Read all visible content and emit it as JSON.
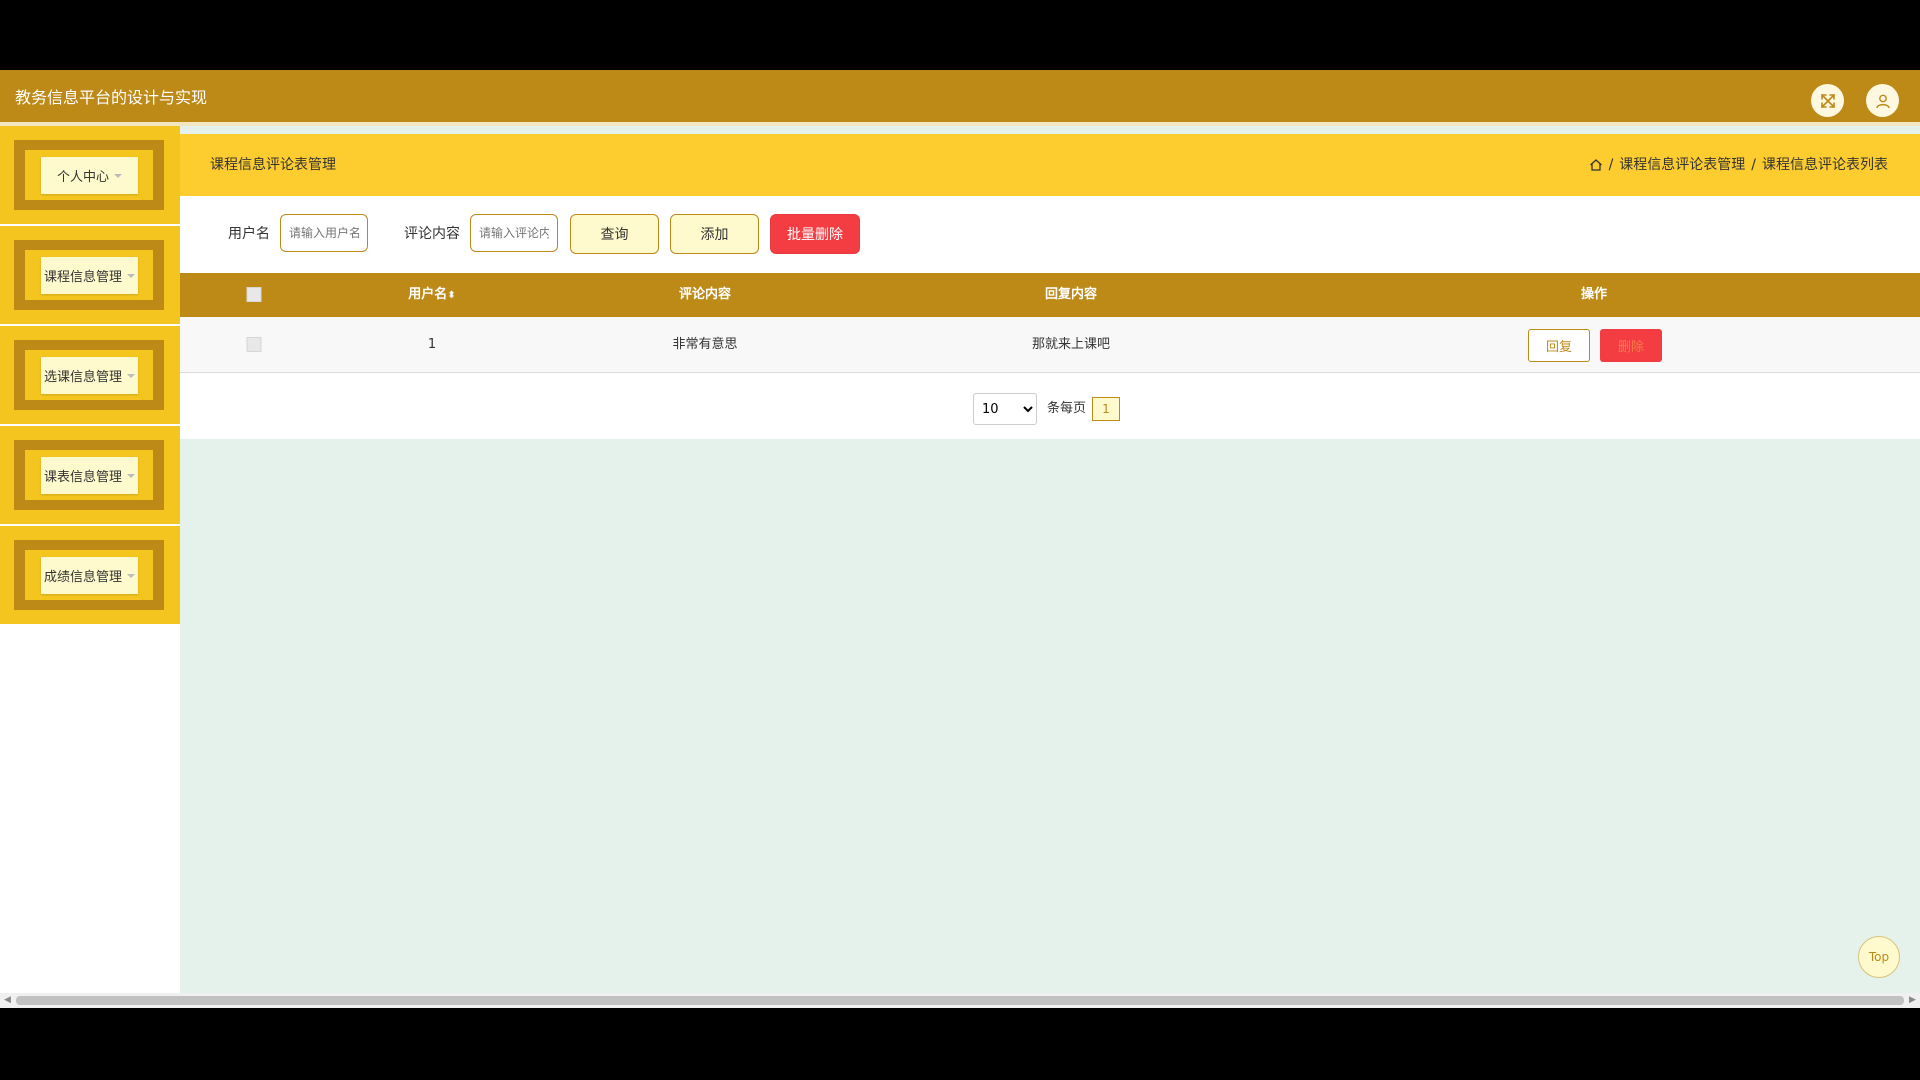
{
  "header": {
    "title": "教务信息平台的设计与实现",
    "fullscreen_icon": "expand-arrows-icon",
    "user_icon": "user-icon"
  },
  "sidebar": {
    "items": [
      {
        "label": "个人中心"
      },
      {
        "label": "课程信息管理"
      },
      {
        "label": "选课信息管理"
      },
      {
        "label": "课表信息管理"
      },
      {
        "label": "成绩信息管理"
      }
    ]
  },
  "page": {
    "title": "课程信息评论表管理",
    "breadcrumb": [
      "课程信息评论表管理",
      "课程信息评论表列表"
    ]
  },
  "search": {
    "username_label": "用户名",
    "username_placeholder": "请输入用户名",
    "content_label": "评论内容",
    "content_placeholder": "请输入评论内容",
    "query_button": "查询",
    "add_button": "添加",
    "batch_delete_button": "批量删除"
  },
  "table": {
    "columns": [
      "用户名",
      "评论内容",
      "回复内容",
      "操作"
    ],
    "rows": [
      {
        "username": "1",
        "content": "非常有意思",
        "reply": "那就来上课吧",
        "reply_button": "回复",
        "delete_button": "删除"
      }
    ]
  },
  "pagination": {
    "page_size": "10",
    "page_size_options": [
      "10"
    ],
    "per_page_label": "条每页",
    "current_page": "1"
  },
  "back_to_top": "Top",
  "colors": {
    "primary": "#bd8a18",
    "accent_yellow": "#fdcd30",
    "light_yellow": "#fffacd",
    "danger": "#f43d42",
    "content_bg": "#e5f2ec"
  }
}
